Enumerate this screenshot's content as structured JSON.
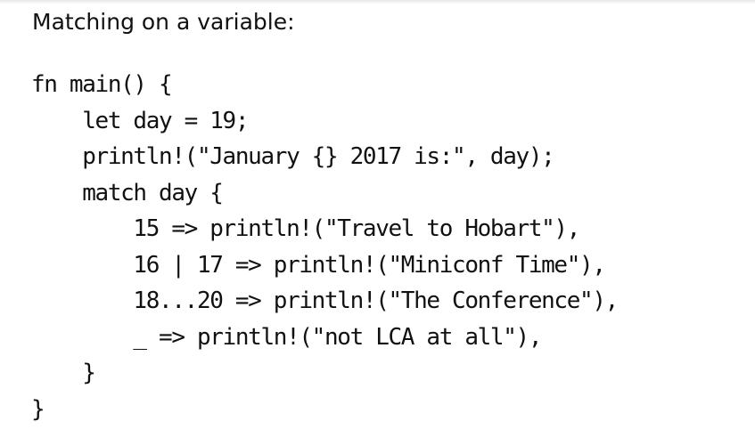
{
  "slide": {
    "heading": "Matching on a variable:",
    "code_lines": [
      "fn main() {",
      "    let day = 19;",
      "    println!(\"January {} 2017 is:\", day);",
      "    match day {",
      "        15 => println!(\"Travel to Hobart\"),",
      "        16 | 17 => println!(\"Miniconf Time\"),",
      "        18...20 => println!(\"The Conference\"),",
      "        _ => println!(\"not LCA at all\"),",
      "    }",
      "}"
    ]
  }
}
